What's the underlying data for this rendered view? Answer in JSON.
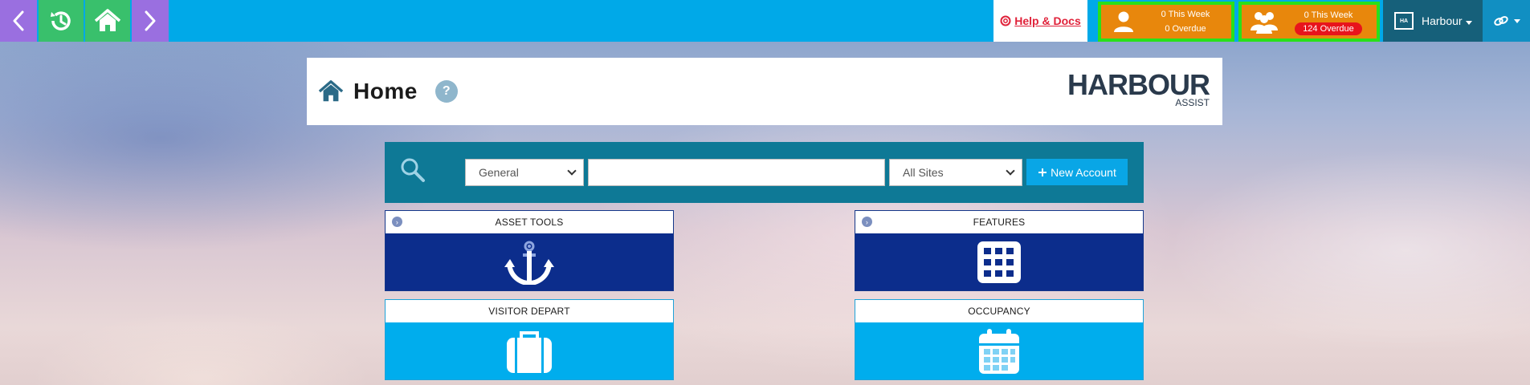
{
  "topbar": {
    "nav": {
      "back_icon": "chevron-left-icon",
      "history_icon": "history-icon",
      "home_icon": "home-icon",
      "forward_icon": "chevron-right-icon"
    },
    "help_link": "Help & Docs",
    "my_tasks": {
      "this_week": "0 This Week",
      "overdue": "0 Overdue"
    },
    "team_tasks": {
      "this_week": "0 This Week",
      "overdue": "124 Overdue"
    },
    "site_menu": "Harbour",
    "site_logo_text": "HA"
  },
  "header": {
    "title": "Home",
    "help": "?",
    "brand_name": "HARBOUR",
    "brand_sub": "ASSIST"
  },
  "search": {
    "type_selected": "General",
    "query": "",
    "site_selected": "All Sites",
    "new_account_label": "New Account"
  },
  "tiles": [
    {
      "label": "ASSET TOOLS",
      "icon": "anchor-icon"
    },
    {
      "label": "FEATURES",
      "icon": "grid-icon"
    },
    {
      "label": "VISITOR DEPART",
      "icon": "suitcase-icon"
    },
    {
      "label": "OCCUPANCY",
      "icon": "calendar-icon"
    }
  ],
  "colors": {
    "topbar": "#00a9e8",
    "nav_purple": "#9a6fe0",
    "nav_green": "#39c06c",
    "task_orange": "#e8870c",
    "task_highlight": "#29e01a",
    "overdue_red": "#e8141c",
    "tile_dark": "#0c2d8c",
    "tile_light": "#00aded",
    "search_bar": "#0e7996"
  }
}
